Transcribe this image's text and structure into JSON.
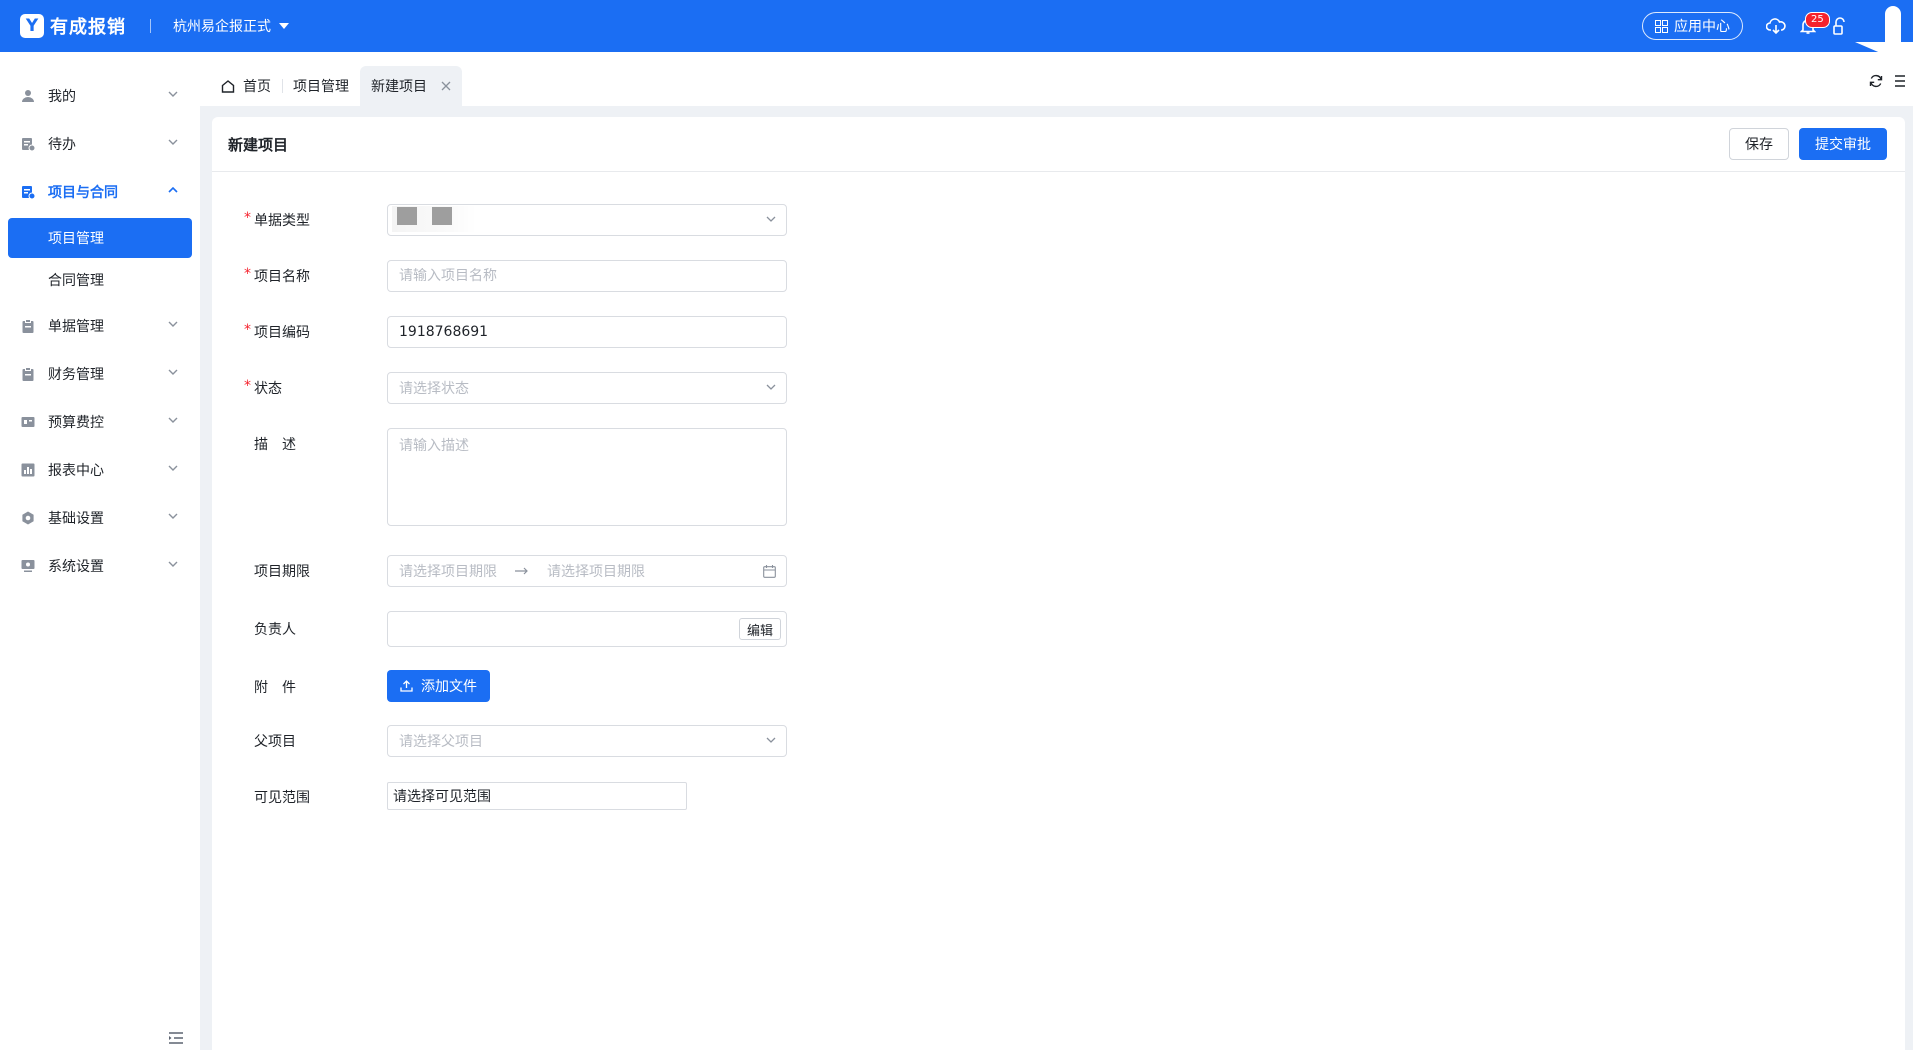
{
  "app": {
    "logo_glyph": "Y",
    "name": "有成报销",
    "org": "杭州易企报正式"
  },
  "topbar": {
    "app_center_label": "应用中心",
    "notification_count": "25",
    "accent_color": "#1b6ef3"
  },
  "sidebar": {
    "items": [
      {
        "label": "我的",
        "icon": "user-icon"
      },
      {
        "label": "待办",
        "icon": "todo-icon"
      },
      {
        "label": "项目与合同",
        "icon": "project-icon",
        "expanded": true,
        "children": [
          {
            "label": "项目管理",
            "active": true
          },
          {
            "label": "合同管理"
          }
        ]
      },
      {
        "label": "单据管理",
        "icon": "clipboard-icon"
      },
      {
        "label": "财务管理",
        "icon": "clipboard-icon"
      },
      {
        "label": "预算费控",
        "icon": "budget-icon"
      },
      {
        "label": "报表中心",
        "icon": "chart-icon"
      },
      {
        "label": "基础设置",
        "icon": "gear-icon"
      },
      {
        "label": "系统设置",
        "icon": "monitor-icon"
      }
    ]
  },
  "tabs": [
    {
      "label": "首页",
      "icon": "home-icon"
    },
    {
      "label": "项目管理"
    },
    {
      "label": "新建项目",
      "active": true,
      "closable": true
    }
  ],
  "page": {
    "title": "新建项目",
    "save_label": "保存",
    "submit_label": "提交审批"
  },
  "form": {
    "doc_type": {
      "label": "单据类型",
      "required": true
    },
    "project_name": {
      "label": "项目名称",
      "required": true,
      "placeholder": "请输入项目名称"
    },
    "project_code": {
      "label": "项目编码",
      "required": true,
      "value": "1918768691"
    },
    "status": {
      "label": "状态",
      "required": true,
      "placeholder": "请选择状态"
    },
    "description": {
      "label": "描　述",
      "placeholder": "请输入描述"
    },
    "period": {
      "label": "项目期限",
      "start_placeholder": "请选择项目期限",
      "end_placeholder": "请选择项目期限"
    },
    "owner": {
      "label": "负责人",
      "edit_label": "编辑"
    },
    "attachment": {
      "label": "附　件",
      "button_label": "添加文件"
    },
    "parent": {
      "label": "父项目",
      "placeholder": "请选择父项目"
    },
    "visibility": {
      "label": "可见范围",
      "value": "请选择可见范围"
    }
  }
}
